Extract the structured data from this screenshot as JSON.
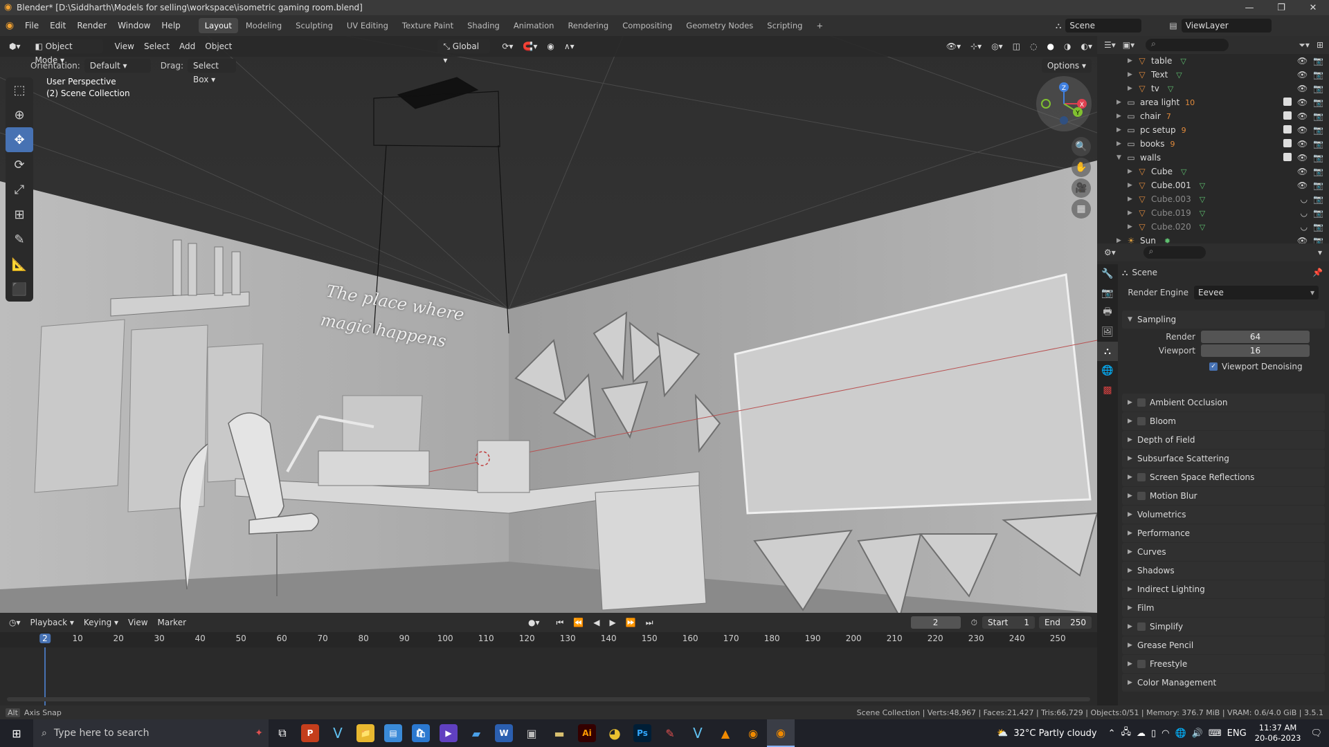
{
  "window": {
    "title": "Blender* [D:\\Siddharth\\Models for selling\\workspace\\isometric gaming room.blend]",
    "controls": [
      "—",
      "❐",
      "✕"
    ]
  },
  "menu": {
    "items": [
      "File",
      "Edit",
      "Render",
      "Window",
      "Help"
    ],
    "workspaces": [
      "Layout",
      "Modeling",
      "Sculpting",
      "UV Editing",
      "Texture Paint",
      "Shading",
      "Animation",
      "Rendering",
      "Compositing",
      "Geometry Nodes",
      "Scripting"
    ],
    "active_workspace": "Layout",
    "add_tab": "+",
    "scene": "Scene",
    "view_layer": "ViewLayer"
  },
  "viewport": {
    "mode": "Object Mode",
    "menus": [
      "View",
      "Select",
      "Add",
      "Object"
    ],
    "transform_orientation": "Global",
    "orientation_label": "Orientation:",
    "orientation_value": "Default",
    "drag_label": "Drag:",
    "drag_value": "Select Box",
    "options": "Options",
    "overlay_line1": "User Perspective",
    "overlay_line2": "(2) Scene Collection",
    "wall_text_1": "The place where",
    "wall_text_2": "magic happens",
    "gizmo": {
      "x": "X",
      "y": "Y",
      "z": "Z"
    }
  },
  "outliner": {
    "rows": [
      {
        "name": "table",
        "indent": 2,
        "type": "mesh",
        "dim": false
      },
      {
        "name": "Text",
        "indent": 2,
        "type": "mesh",
        "dim": false
      },
      {
        "name": "tv",
        "indent": 2,
        "type": "mesh",
        "dim": false
      },
      {
        "name": "area light",
        "indent": 1,
        "type": "collection",
        "badge": "10",
        "dim": false
      },
      {
        "name": "chair",
        "indent": 1,
        "type": "collection",
        "badge": "7",
        "dim": false
      },
      {
        "name": "pc setup",
        "indent": 1,
        "type": "collection",
        "badge": "9",
        "dim": false
      },
      {
        "name": "books",
        "indent": 1,
        "type": "collection",
        "badge": "9",
        "dim": false
      },
      {
        "name": "walls",
        "indent": 1,
        "type": "collection",
        "dim": false
      },
      {
        "name": "Cube",
        "indent": 2,
        "type": "mesh",
        "dim": false
      },
      {
        "name": "Cube.001",
        "indent": 2,
        "type": "mesh",
        "dim": false
      },
      {
        "name": "Cube.003",
        "indent": 2,
        "type": "mesh",
        "dim": true
      },
      {
        "name": "Cube.019",
        "indent": 2,
        "type": "mesh",
        "dim": true
      },
      {
        "name": "Cube.020",
        "indent": 2,
        "type": "mesh",
        "dim": true
      },
      {
        "name": "Sun",
        "indent": 1,
        "type": "light",
        "dim": false
      }
    ]
  },
  "properties": {
    "context": "Scene",
    "render_engine_label": "Render Engine",
    "render_engine": "Eevee",
    "sampling": "Sampling",
    "render_label": "Render",
    "render_value": "64",
    "viewport_label": "Viewport",
    "viewport_value": "16",
    "denoise_label": "Viewport Denoising",
    "panels": [
      {
        "label": "Ambient Occlusion",
        "checkbox": true
      },
      {
        "label": "Bloom",
        "checkbox": true
      },
      {
        "label": "Depth of Field",
        "checkbox": false
      },
      {
        "label": "Subsurface Scattering",
        "checkbox": false
      },
      {
        "label": "Screen Space Reflections",
        "checkbox": true
      },
      {
        "label": "Motion Blur",
        "checkbox": true
      },
      {
        "label": "Volumetrics",
        "checkbox": false
      },
      {
        "label": "Performance",
        "checkbox": false
      },
      {
        "label": "Curves",
        "checkbox": false
      },
      {
        "label": "Shadows",
        "checkbox": false
      },
      {
        "label": "Indirect Lighting",
        "checkbox": false
      },
      {
        "label": "Film",
        "checkbox": false
      },
      {
        "label": "Simplify",
        "checkbox": true
      },
      {
        "label": "Grease Pencil",
        "checkbox": false
      },
      {
        "label": "Freestyle",
        "checkbox": true
      },
      {
        "label": "Color Management",
        "checkbox": false
      }
    ]
  },
  "timeline": {
    "menus": [
      "Playback",
      "Keying",
      "View",
      "Marker"
    ],
    "current_frame": "2",
    "start_label": "Start",
    "start": "1",
    "end_label": "End",
    "end": "250",
    "ticks": [
      "10",
      "20",
      "30",
      "40",
      "50",
      "60",
      "70",
      "80",
      "90",
      "100",
      "110",
      "120",
      "130",
      "140",
      "150",
      "160",
      "170",
      "180",
      "190",
      "200",
      "210",
      "220",
      "230",
      "240",
      "250"
    ]
  },
  "status": {
    "left_key": "Alt",
    "left": "Axis Snap",
    "right": "Scene Collection | Verts:48,967 | Faces:21,427 | Tris:66,729 | Objects:0/51 | Memory: 376.7 MiB | VRAM: 0.6/4.0 GiB | 3.5.1"
  },
  "taskbar": {
    "search_placeholder": "Type here to search",
    "weather": "32°C  Partly cloudy",
    "lang": "ENG",
    "time": "11:37 AM",
    "date": "20-06-2023"
  }
}
